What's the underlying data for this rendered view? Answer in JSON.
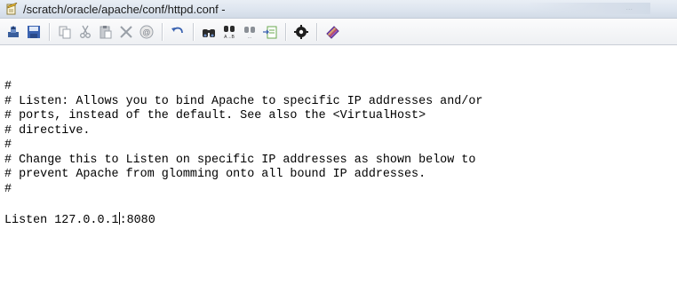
{
  "window": {
    "title": "/scratch/oracle/apache/conf/httpd.conf -",
    "title_right_text": "..."
  },
  "toolbar": {
    "buttons": [
      {
        "icon": "open-icon"
      },
      {
        "icon": "save-icon"
      },
      {
        "icon": "copy-icon"
      },
      {
        "icon": "cut-icon"
      },
      {
        "icon": "paste-icon"
      },
      {
        "icon": "delete-icon"
      },
      {
        "icon": "select-all-icon"
      },
      {
        "icon": "undo-icon"
      },
      {
        "icon": "find-icon"
      },
      {
        "icon": "replace-icon"
      },
      {
        "icon": "find-next-icon"
      },
      {
        "icon": "go-to-icon"
      },
      {
        "icon": "settings-icon"
      },
      {
        "icon": "plugin-icon"
      }
    ]
  },
  "editor": {
    "lines": [
      "#",
      "# Listen: Allows you to bind Apache to specific IP addresses and/or",
      "# ports, instead of the default. See also the <VirtualHost>",
      "# directive.",
      "#",
      "# Change this to Listen on specific IP addresses as shown below to",
      "# prevent Apache from glomming onto all bound IP addresses.",
      "#",
      ""
    ],
    "listen_line": {
      "prefix": "Listen 127.0.0.1",
      "suffix": ":8080"
    }
  },
  "colors": {
    "title_bar": "#dde5ef",
    "toolbar": "#eef0f3",
    "text": "#000000"
  }
}
